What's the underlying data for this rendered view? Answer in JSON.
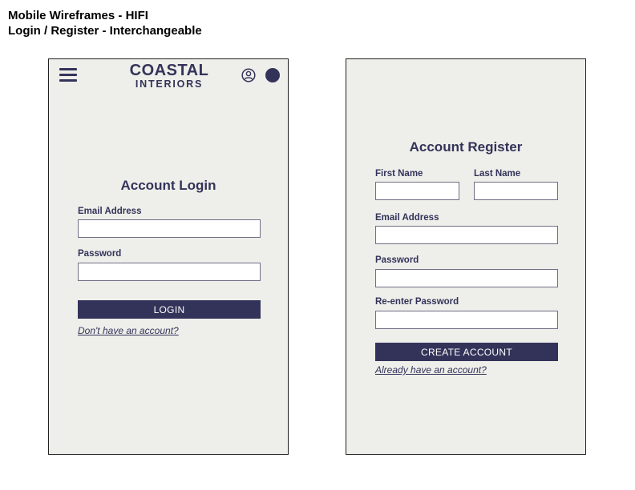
{
  "page": {
    "title_line1": "Mobile Wireframes - HIFI",
    "title_line2": "Login / Register - Interchangeable"
  },
  "brand": {
    "name_top": "COASTAL",
    "name_bottom": "INTERIORS"
  },
  "icons": {
    "menu": "hamburger-menu-icon",
    "account": "user-circle-icon",
    "cart": "cart-dot-icon"
  },
  "login": {
    "title": "Account Login",
    "email_label": "Email Address",
    "email_value": "",
    "password_label": "Password",
    "password_value": "",
    "button_label": "LOGIN",
    "switch_link": "Don't have an account?"
  },
  "register": {
    "title": "Account Register",
    "first_name_label": "First Name",
    "first_name_value": "",
    "last_name_label": "Last Name",
    "last_name_value": "",
    "email_label": "Email Address",
    "email_value": "",
    "password_label": "Password",
    "password_value": "",
    "reenter_password_label": "Re-enter Password",
    "reenter_password_value": "",
    "button_label": "CREATE ACCOUNT",
    "switch_link": "Already have an account?"
  },
  "colors": {
    "brand_navy": "#33335a",
    "screen_bg": "#eeeeea",
    "input_border": "#6f6f86"
  }
}
